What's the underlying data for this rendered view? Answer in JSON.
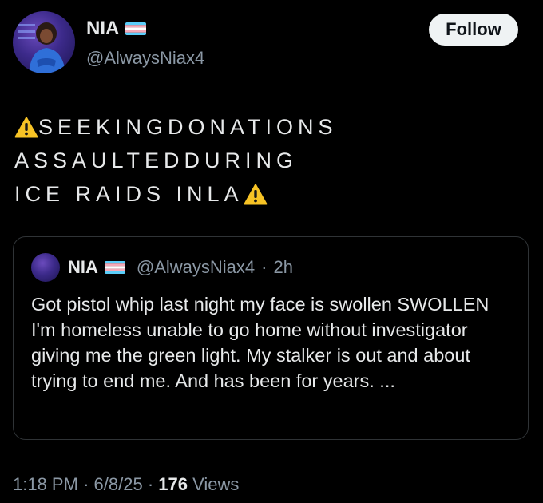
{
  "author": {
    "name": "NIA",
    "handle": "@AlwaysNiax4",
    "flag_icon": "transgender-flag-icon",
    "avatar_icon": "avatar"
  },
  "follow_label": "Follow",
  "tweet": {
    "lines": [
      "SEEKINGDONATIONS",
      "ASSAULTEDDURING",
      "ICE RAIDS INLA"
    ],
    "warning_icon": "warning-icon"
  },
  "quote": {
    "name": "NIA",
    "handle": "@AlwaysNiax4",
    "separator": "·",
    "time": "2h",
    "text": "Got pistol whip last night my face is swollen SWOLLEN I'm homeless unable to go home without investigator giving me the green light. My stalker is out and about trying to end me. And has been for years. ..."
  },
  "meta": {
    "time": "1:18 PM",
    "separator": "·",
    "date": "6/8/25",
    "views_count": "176",
    "views_label": "Views"
  },
  "colors": {
    "background": "#000000",
    "text": "#e7e9ea",
    "secondary": "#8b98a5",
    "border": "#2f3336",
    "button_bg": "#eff3f4"
  }
}
